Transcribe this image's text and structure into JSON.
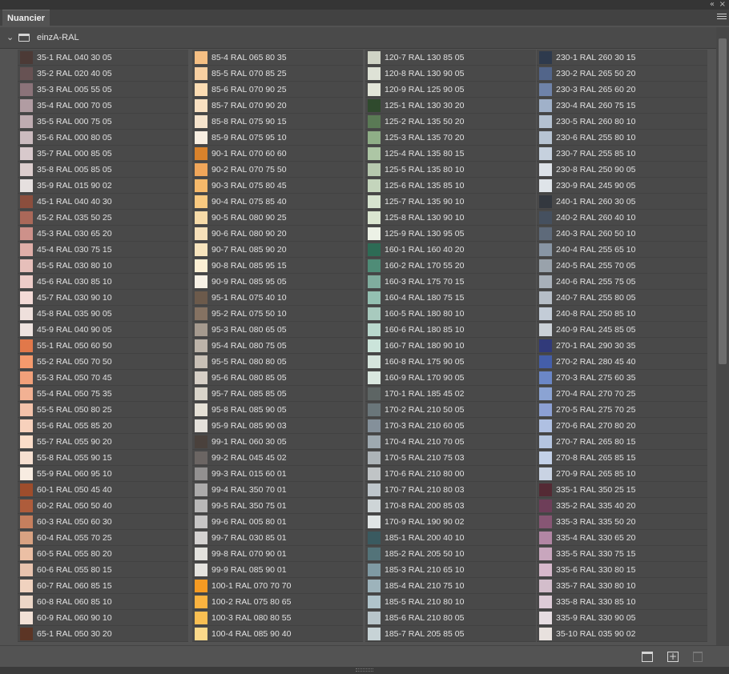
{
  "panel": {
    "tab_label": "Nuancier",
    "collapse_glyph": "«",
    "close_glyph": "×"
  },
  "group": {
    "name": "einzA-RAL"
  },
  "swatch_columns": [
    [
      {
        "label": "35-1 RAL 040 30 05",
        "color": "#4c3a36"
      },
      {
        "label": "35-2 RAL 020 40 05",
        "color": "#675253"
      },
      {
        "label": "35-3 RAL 005 55 05",
        "color": "#8b7379"
      },
      {
        "label": "35-4 RAL 000 70 05",
        "color": "#b19ca2"
      },
      {
        "label": "35-5 RAL 000 75 05",
        "color": "#bfacb1"
      },
      {
        "label": "35-6 RAL 000 80 05",
        "color": "#cbbbbf"
      },
      {
        "label": "35-7 RAL 000 85 05",
        "color": "#d8c9cc"
      },
      {
        "label": "35-8 RAL 005 85 05",
        "color": "#dccdcd"
      },
      {
        "label": "35-9 RAL 015 90 02",
        "color": "#e6e0df"
      },
      {
        "label": "45-1 RAL 040 40 30",
        "color": "#8b4e3d"
      },
      {
        "label": "45-2 RAL 035 50 25",
        "color": "#aa6859"
      },
      {
        "label": "45-3 RAL 030 65 20",
        "color": "#cd918a"
      },
      {
        "label": "45-4 RAL 030 75 15",
        "color": "#dfaea8"
      },
      {
        "label": "45-5 RAL 030 80 10",
        "color": "#e6bfba"
      },
      {
        "label": "45-6 RAL 030 85 10",
        "color": "#edccc8"
      },
      {
        "label": "45-7 RAL 030 90 10",
        "color": "#f3dad6"
      },
      {
        "label": "45-8 RAL 035 90 05",
        "color": "#efe0dc"
      },
      {
        "label": "45-9 RAL 040 90 05",
        "color": "#eee3df"
      },
      {
        "label": "55-1 RAL 050 60 50",
        "color": "#e1784a"
      },
      {
        "label": "55-2 RAL 050 70 50",
        "color": "#f59a6d"
      },
      {
        "label": "55-3 RAL 050 70 45",
        "color": "#f2a07a"
      },
      {
        "label": "55-4 RAL 050 75 35",
        "color": "#f2b193"
      },
      {
        "label": "55-5 RAL 050 80 25",
        "color": "#f3c2aa"
      },
      {
        "label": "55-6 RAL 055 85 20",
        "color": "#f7d1bc"
      },
      {
        "label": "55-7 RAL 055 90 20",
        "color": "#fbddc9"
      },
      {
        "label": "55-8 RAL 055 90 15",
        "color": "#f7e0d1"
      },
      {
        "label": "55-9 RAL 060 95 10",
        "color": "#f8ece1"
      },
      {
        "label": "60-1 RAL 050 45 40",
        "color": "#9e4d2c"
      },
      {
        "label": "60-2 RAL 050 50 40",
        "color": "#ae5c3b"
      },
      {
        "label": "60-3 RAL 050 60 30",
        "color": "#c67f5e"
      },
      {
        "label": "60-4 RAL 055 70 25",
        "color": "#d9a282"
      },
      {
        "label": "60-5 RAL 055 80 20",
        "color": "#ebbfa4"
      },
      {
        "label": "60-6 RAL 055 80 15",
        "color": "#e8c3ae"
      },
      {
        "label": "60-7 RAL 060 85 15",
        "color": "#f0d2bf"
      },
      {
        "label": "60-8 RAL 060 85 10",
        "color": "#ecd6c7"
      },
      {
        "label": "60-9 RAL 060 90 10",
        "color": "#f2e1d6"
      },
      {
        "label": "65-1 RAL 050 30 20",
        "color": "#5c3525"
      }
    ],
    [
      {
        "label": "85-4 RAL 065 80 35",
        "color": "#f5bf83"
      },
      {
        "label": "85-5 RAL 070 85 25",
        "color": "#f7cfa1"
      },
      {
        "label": "85-6 RAL 070 90 25",
        "color": "#fbdcb3"
      },
      {
        "label": "85-7 RAL 070 90 20",
        "color": "#f8e0c1"
      },
      {
        "label": "85-8 RAL 075 90 15",
        "color": "#f5e3cc"
      },
      {
        "label": "85-9 RAL 075 95 10",
        "color": "#f8eee1"
      },
      {
        "label": "90-1 RAL 070 60 60",
        "color": "#d9822b"
      },
      {
        "label": "90-2 RAL 070 75 50",
        "color": "#f0a65a"
      },
      {
        "label": "90-3 RAL 075 80 45",
        "color": "#f6b96a"
      },
      {
        "label": "90-4 RAL 075 85 40",
        "color": "#f9c980"
      },
      {
        "label": "90-5 RAL 080 90 25",
        "color": "#f7dba8"
      },
      {
        "label": "90-6 RAL 080 90 20",
        "color": "#f6e0b9"
      },
      {
        "label": "90-7 RAL 085 90 20",
        "color": "#f7e4bd"
      },
      {
        "label": "90-8 RAL 085 95 15",
        "color": "#fbefd3"
      },
      {
        "label": "90-9 RAL 085 95 05",
        "color": "#f7f1e5"
      },
      {
        "label": "95-1 RAL 075 40 10",
        "color": "#6c5a4b"
      },
      {
        "label": "95-2 RAL 075 50 10",
        "color": "#857262"
      },
      {
        "label": "95-3 RAL 080 65 05",
        "color": "#a59a8f"
      },
      {
        "label": "95-4 RAL 080 75 05",
        "color": "#bcb3a9"
      },
      {
        "label": "95-5 RAL 080 80 05",
        "color": "#c8c0b6"
      },
      {
        "label": "95-6 RAL 080 85 05",
        "color": "#d6cfc6"
      },
      {
        "label": "95-7 RAL 085 85 05",
        "color": "#d8d3c9"
      },
      {
        "label": "95-8 RAL 085 90 05",
        "color": "#e5e0d6"
      },
      {
        "label": "95-9 RAL 085 90 03",
        "color": "#e4e0da"
      },
      {
        "label": "99-1 RAL 060 30 05",
        "color": "#4a413c"
      },
      {
        "label": "99-2 RAL 045 45 02",
        "color": "#6b6563"
      },
      {
        "label": "99-3 RAL 015 60 01",
        "color": "#929090"
      },
      {
        "label": "99-4 RAL 350 70 01",
        "color": "#acabab"
      },
      {
        "label": "99-5 RAL 350 75 01",
        "color": "#b9b8b8"
      },
      {
        "label": "99-6 RAL 005 80 01",
        "color": "#c6c5c5"
      },
      {
        "label": "99-7 RAL 030 85 01",
        "color": "#d4d2d1"
      },
      {
        "label": "99-8 RAL 070 90 01",
        "color": "#e2e1dd"
      },
      {
        "label": "99-9 RAL 085 90 01",
        "color": "#e4e3df"
      },
      {
        "label": "100-1 RAL 070 70 70",
        "color": "#f59a22"
      },
      {
        "label": "100-2 RAL 075 80 65",
        "color": "#fab340"
      },
      {
        "label": "100-3 RAL 080 80 55",
        "color": "#f9bf52"
      },
      {
        "label": "100-4 RAL 085 90 40",
        "color": "#fbd98a"
      }
    ],
    [
      {
        "label": "120-7 RAL 130 85 05",
        "color": "#cfd3c5"
      },
      {
        "label": "120-8 RAL 130 90 05",
        "color": "#dee2d6"
      },
      {
        "label": "120-9 RAL 125 90 05",
        "color": "#e2e5d8"
      },
      {
        "label": "125-1 RAL 130 30 20",
        "color": "#2f4a2d"
      },
      {
        "label": "125-2 RAL 135 50 20",
        "color": "#5a7a55"
      },
      {
        "label": "125-3 RAL 135 70 20",
        "color": "#8fae87"
      },
      {
        "label": "125-4 RAL 135 80 15",
        "color": "#adc6a5"
      },
      {
        "label": "125-5 RAL 135 80 10",
        "color": "#b6c8ae"
      },
      {
        "label": "125-6 RAL 135 85 10",
        "color": "#c4d5bc"
      },
      {
        "label": "125-7 RAL 135 90 10",
        "color": "#d6e3cf"
      },
      {
        "label": "125-8 RAL 130 90 10",
        "color": "#dae5d0"
      },
      {
        "label": "125-9 RAL 130 95 05",
        "color": "#ecf1e6"
      },
      {
        "label": "160-1 RAL 160 40 20",
        "color": "#2d6b55"
      },
      {
        "label": "160-2 RAL 170 55 20",
        "color": "#4f8c77"
      },
      {
        "label": "160-3 RAL 175 70 15",
        "color": "#80ad9e"
      },
      {
        "label": "160-4 RAL 180 75 15",
        "color": "#94c0b2"
      },
      {
        "label": "160-5 RAL 180 80 10",
        "color": "#a8cabe"
      },
      {
        "label": "160-6 RAL 180 85 10",
        "color": "#b9d8cd"
      },
      {
        "label": "160-7 RAL 180 90 10",
        "color": "#cbe4da"
      },
      {
        "label": "160-8 RAL 175 90 05",
        "color": "#d5e4dc"
      },
      {
        "label": "160-9 RAL 170 90 05",
        "color": "#d9e7df"
      },
      {
        "label": "170-1 RAL 185 45 02",
        "color": "#5d6564"
      },
      {
        "label": "170-2 RAL 210 50 05",
        "color": "#6a767a"
      },
      {
        "label": "170-3 RAL 210 60 05",
        "color": "#84909a"
      },
      {
        "label": "170-4 RAL 210 70 05",
        "color": "#9ea9b0"
      },
      {
        "label": "170-5 RAL 210 75 03",
        "color": "#adb4b8"
      },
      {
        "label": "170-6 RAL 210 80 00",
        "color": "#c0c4c6"
      },
      {
        "label": "170-7 RAL 210 80 03",
        "color": "#bec6cb"
      },
      {
        "label": "170-8 RAL 200 85 03",
        "color": "#ced5d7"
      },
      {
        "label": "170-9 RAL 190 90 02",
        "color": "#e0e5e5"
      },
      {
        "label": "185-1 RAL 200 40 10",
        "color": "#3a5a60"
      },
      {
        "label": "185-2 RAL 205 50 10",
        "color": "#537379"
      },
      {
        "label": "185-3 RAL 210 65 10",
        "color": "#7f9aa3"
      },
      {
        "label": "185-4 RAL 210 75 10",
        "color": "#9db3bb"
      },
      {
        "label": "185-5 RAL 210 80 10",
        "color": "#b0c4cb"
      },
      {
        "label": "185-6 RAL 210 80 05",
        "color": "#b8c5ca"
      },
      {
        "label": "185-7 RAL 205 85 05",
        "color": "#c7d3d6"
      }
    ],
    [
      {
        "label": "230-1 RAL 260 30 15",
        "color": "#2e3a4d"
      },
      {
        "label": "230-2 RAL 265 50 20",
        "color": "#52658a"
      },
      {
        "label": "230-3 RAL 265 60 20",
        "color": "#6f83a9"
      },
      {
        "label": "230-4 RAL 260 75 15",
        "color": "#a0b1c9"
      },
      {
        "label": "230-5 RAL 260 80 10",
        "color": "#b4c1d1"
      },
      {
        "label": "230-6 RAL 255 80 10",
        "color": "#b7c4d3"
      },
      {
        "label": "230-7 RAL 255 85 10",
        "color": "#c6d1de"
      },
      {
        "label": "230-8 RAL 250 90 05",
        "color": "#dde2e8"
      },
      {
        "label": "230-9 RAL 245 90 05",
        "color": "#dfe4e9"
      },
      {
        "label": "240-1 RAL 260 30 05",
        "color": "#33383f"
      },
      {
        "label": "240-2 RAL 260 40 10",
        "color": "#45505f"
      },
      {
        "label": "240-3 RAL 260 50 10",
        "color": "#5e6a7a"
      },
      {
        "label": "240-4 RAL 255 65 10",
        "color": "#8895a4"
      },
      {
        "label": "240-5 RAL 255 70 05",
        "color": "#99a2ab"
      },
      {
        "label": "240-6 RAL 255 75 05",
        "color": "#a8b0b9"
      },
      {
        "label": "240-7 RAL 255 80 05",
        "color": "#b6bec7"
      },
      {
        "label": "240-8 RAL 250 85 10",
        "color": "#c3ccd7"
      },
      {
        "label": "240-9 RAL 245 85 05",
        "color": "#cbd1d7"
      },
      {
        "label": "270-1 RAL 290 30 35",
        "color": "#313a7a"
      },
      {
        "label": "270-2 RAL 280 45 40",
        "color": "#445ea9"
      },
      {
        "label": "270-3 RAL 275 60 35",
        "color": "#6b87c7"
      },
      {
        "label": "270-4 RAL 270 70 25",
        "color": "#8ba3d3"
      },
      {
        "label": "270-5 RAL 275 70 25",
        "color": "#8ca0d4"
      },
      {
        "label": "270-6 RAL 270 80 20",
        "color": "#afc0e2"
      },
      {
        "label": "270-7 RAL 265 80 15",
        "color": "#b5c5e0"
      },
      {
        "label": "270-8 RAL 265 85 15",
        "color": "#c3d1e8"
      },
      {
        "label": "270-9 RAL 265 85 10",
        "color": "#c9d3e3"
      },
      {
        "label": "335-1 RAL 350 25 15",
        "color": "#542a34"
      },
      {
        "label": "335-2 RAL 335 40 20",
        "color": "#6e3e59"
      },
      {
        "label": "335-3 RAL 335 50 20",
        "color": "#875674"
      },
      {
        "label": "335-4 RAL 330 65 20",
        "color": "#b286a4"
      },
      {
        "label": "335-5 RAL 330 75 15",
        "color": "#c8a6bd"
      },
      {
        "label": "335-6 RAL 330 80 15",
        "color": "#d6b8cb"
      },
      {
        "label": "335-7 RAL 330 80 10",
        "color": "#d3bdcb"
      },
      {
        "label": "335-8 RAL 330 85 10",
        "color": "#ddcbd7"
      },
      {
        "label": "335-9 RAL 330 90 05",
        "color": "#e6dde2"
      },
      {
        "label": "35-10 RAL 035 90 02",
        "color": "#e8e1de"
      }
    ]
  ]
}
